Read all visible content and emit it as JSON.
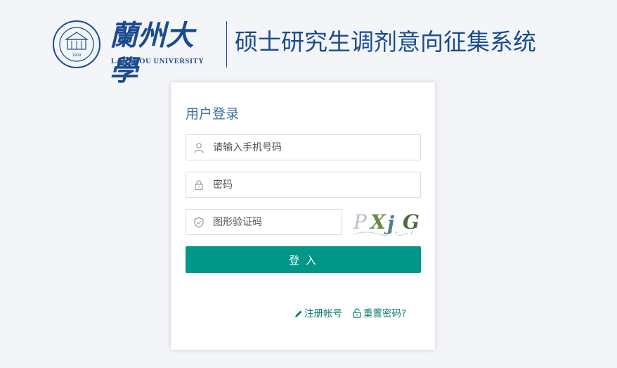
{
  "header": {
    "university_name_cn": "蘭州大學",
    "university_name_en": "LANZHOU UNIVERSITY",
    "system_title": "硕士研究生调剂意向征集系统",
    "seal_year": "1909",
    "seal_icon": "university-seal-icon",
    "brand_color": "#1b4b8f"
  },
  "login": {
    "title": "用户登录",
    "phone": {
      "placeholder": "请输入手机号码",
      "value": "",
      "icon": "user-icon"
    },
    "password": {
      "placeholder": "密码",
      "value": "",
      "icon": "lock-icon"
    },
    "captcha": {
      "placeholder": "图形验证码",
      "value": "",
      "icon": "shield-icon",
      "image_text": "PXjG"
    },
    "submit_label": "登 入",
    "submit_color": "#009688",
    "register_label": "注册帐号",
    "register_icon": "pencil-icon",
    "reset_label": "重置密码?",
    "reset_icon": "unlock-icon"
  }
}
